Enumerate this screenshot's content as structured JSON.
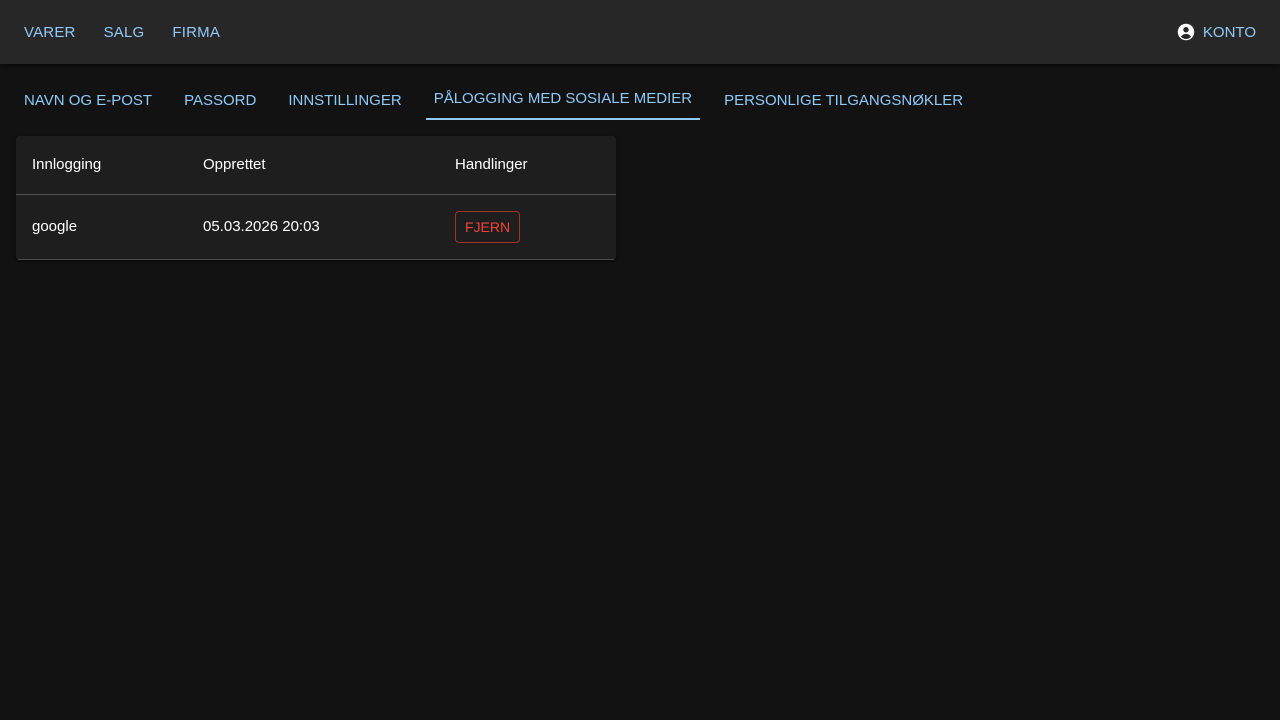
{
  "topnav": {
    "items": [
      {
        "label": "VARER"
      },
      {
        "label": "SALG"
      },
      {
        "label": "FIRMA"
      }
    ],
    "account_label": "KONTO",
    "account_icon": "account-circle-icon"
  },
  "tabs": [
    {
      "label": "NAVN OG E-POST",
      "active": false
    },
    {
      "label": "PASSORD",
      "active": false
    },
    {
      "label": "INNSTILLINGER",
      "active": false
    },
    {
      "label": "PÅLOGGING MED SOSIALE MEDIER",
      "active": true
    },
    {
      "label": "PERSONLIGE TILGANGSNØKLER",
      "active": false
    }
  ],
  "table": {
    "headers": [
      "Innlogging",
      "Opprettet",
      "Handlinger"
    ],
    "rows": [
      {
        "provider": "google",
        "created": "05.03.2026 20:03",
        "action_label": "FJERN"
      }
    ]
  },
  "colors": {
    "background": "#121212",
    "appbar": "#272727",
    "accent": "#90caf9",
    "danger": "#f44336",
    "card": "#1e1e1e"
  }
}
